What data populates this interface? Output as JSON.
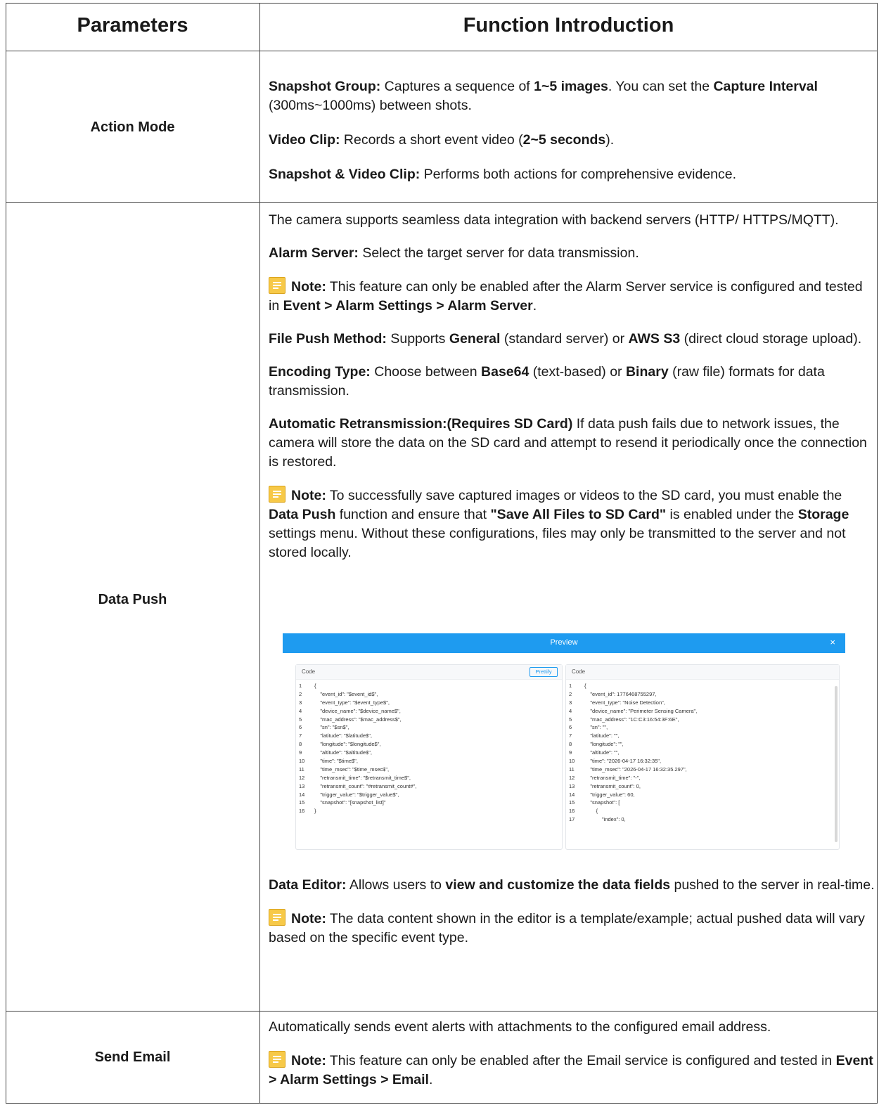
{
  "header": {
    "col1": "Parameters",
    "col2": "Function Introduction"
  },
  "action_mode": {
    "param": "Action Mode",
    "snapshot_group_label": "Snapshot Group:",
    "snapshot_group_text1": " Captures a sequence of ",
    "snapshot_group_count": "1~5 images",
    "snapshot_group_text2": ". You can set the ",
    "capture_interval": "Capture Interval",
    "snapshot_group_text3": " (300ms~1000ms) between shots.",
    "video_clip_label": "Video Clip:",
    "video_clip_text1": " Records a short event video (",
    "video_clip_seconds": "2~5 seconds",
    "video_clip_text2": ").",
    "snap_video_label": "Snapshot & Video Clip:",
    "snap_video_text": " Performs both actions for comprehensive evidence."
  },
  "data_push": {
    "param": "Data Push",
    "intro": "The camera supports seamless data integration with backend servers (HTTP/ HTTPS/MQTT).",
    "alarm_server_label": "Alarm Server:",
    "alarm_server_text": " Select the target server for data transmission.",
    "note_label": "Note:",
    "note1_text": "  This feature can only be enabled after the Alarm Server service is configured and tested in ",
    "note1_path": "Event > Alarm Settings > Alarm Server",
    "period": ".",
    "file_push_label": "File Push Method:",
    "file_push_text1": " Supports ",
    "file_push_general": "General",
    "file_push_text2": " (standard server) or ",
    "file_push_aws": "AWS S3",
    "file_push_text3": " (direct cloud storage upload).",
    "encoding_label": "Encoding Type:",
    "encoding_text1": " Choose between ",
    "encoding_base64": "Base64",
    "encoding_text2": " (text-based) or ",
    "encoding_binary": "Binary",
    "encoding_text3": " (raw file) formats for data transmission.",
    "retrans_label": "Automatic Retransmission:(Requires SD Card)",
    "retrans_text": " If data push fails due to network issues, the camera will store the data on the SD card and attempt to resend it periodically once the connection is restored.",
    "note2_text1": "  To successfully save captured images or videos to the SD card, you must enable the ",
    "note2_data_push": "Data Push",
    "note2_text2": " function and ensure that ",
    "note2_save_all": "\"Save All Files to SD Card\"",
    "note2_text3": " is enabled under the ",
    "note2_storage": "Storage",
    "note2_text4": " settings menu. Without these configurations, files may only be transmitted to the server and not stored locally.",
    "editor_label": "Data Editor:",
    "editor_text1": " Allows users to ",
    "editor_bold": "view and customize the data fields",
    "editor_text2": " pushed to the server in real-time.",
    "note3_text": "  The data content shown in the editor is a template/example; actual pushed data will vary based on the specific event type.",
    "preview": {
      "title": "Preview",
      "close": "×",
      "left_header": "Code",
      "right_header": "Code",
      "prettify": "Prettify",
      "left_lines": [
        "{",
        "    \"event_id\": \"$event_id$\",",
        "    \"event_type\": \"$event_type$\",",
        "    \"device_name\": \"$device_name$\",",
        "    \"mac_address\": \"$mac_address$\",",
        "    \"sn\": \"$sn$\",",
        "    \"latitude\": \"$latitude$\",",
        "    \"longitude\": \"$longitude$\",",
        "    \"altitude\": \"$altitude$\",",
        "    \"time\": \"$time$\",",
        "    \"time_msec\": \"$time_msec$\",",
        "    \"retransmit_time\": \"$retransmit_time$\",",
        "    \"retransmit_count\": \"#retransmit_count#\",",
        "    \"trigger_value\": \"$trigger_value$\",",
        "    \"snapshot\": \"[snapshot_list]\"",
        "}"
      ],
      "right_lines": [
        "{",
        "    \"event_id\": 1776468755297,",
        "    \"event_type\": \"Noise Detection\",",
        "    \"device_name\": \"Perimeter Sensing Camera\",",
        "    \"mac_address\": \"1C:C3:16:54:3F:6E\",",
        "    \"sn\": \"\",",
        "    \"latitude\": \"\",",
        "    \"longitude\": \"\",",
        "    \"altitude\": \"\",",
        "    \"time\": \"2026-04-17 16:32:35\",",
        "    \"time_msec\": \"2026-04-17 16:32:35.297\",",
        "    \"retransmit_time\": \"-\",",
        "    \"retransmit_count\": 0,",
        "    \"trigger_value\": 60,",
        "    \"snapshot\": [",
        "        {",
        "            \"index\": 0,"
      ]
    }
  },
  "send_email": {
    "param": "Send Email",
    "text": "Automatically sends event alerts with attachments to the configured email address.",
    "note_text": "  This feature can only be enabled after the Email service is configured and tested in ",
    "note_path": "Event > Alarm Settings > Email"
  }
}
